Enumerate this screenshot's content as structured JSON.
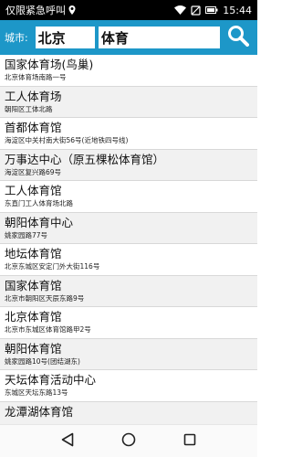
{
  "status": {
    "carrier": "仅限紧急呼叫",
    "time": "15:44",
    "icons": [
      "location-icon",
      "wifi-icon",
      "no-sim-icon",
      "battery-icon"
    ]
  },
  "search": {
    "city_label": "城市:",
    "city_value": "北京",
    "keyword_value": "体育",
    "accent": "#1d97c8"
  },
  "results": [
    {
      "name": "国家体育场(鸟巢)",
      "address": "北京体育场南路一号"
    },
    {
      "name": "工人体育场",
      "address": "朝阳区工体北路"
    },
    {
      "name": "首都体育馆",
      "address": "海淀区中关村南大街56号(近地铁四号线)"
    },
    {
      "name": "万事达中心（原五棵松体育馆）",
      "address": "海淀区复兴路69号"
    },
    {
      "name": "工人体育馆",
      "address": "东直门工人体育场北路"
    },
    {
      "name": "朝阳体育中心",
      "address": "姚家园路77号"
    },
    {
      "name": "地坛体育馆",
      "address": "北京东城区安定门外大街116号"
    },
    {
      "name": "国家体育馆",
      "address": "北京市朝阳区天辰东路9号"
    },
    {
      "name": "北京体育馆",
      "address": "北京市东城区体育馆路甲2号"
    },
    {
      "name": "朝阳体育馆",
      "address": "姚家园路10号(团结湖东)"
    },
    {
      "name": "天坛体育活动中心",
      "address": "东城区天坛东路13号"
    },
    {
      "name": "龙潭湖体育馆",
      "address": ""
    }
  ]
}
